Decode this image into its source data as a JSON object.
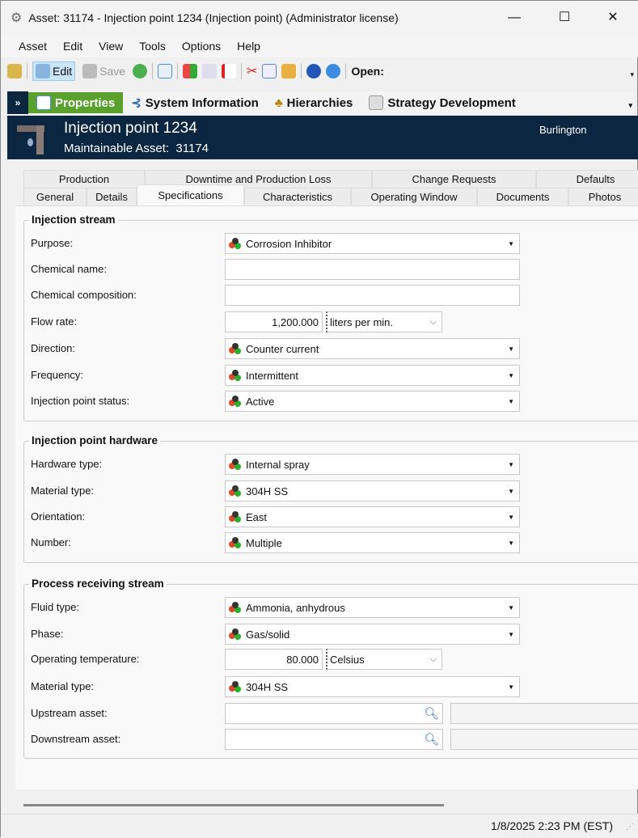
{
  "window": {
    "title": "Asset: 31174 - Injection point 1234 (Injection point) (Administrator license)"
  },
  "menu": [
    "Asset",
    "Edit",
    "View",
    "Tools",
    "Options",
    "Help"
  ],
  "toolbar": {
    "edit": "Edit",
    "save": "Save",
    "open": "Open:"
  },
  "nav": {
    "items": [
      "Properties",
      "System Information",
      "Hierarchies",
      "Strategy Development"
    ]
  },
  "header": {
    "title": "Injection point 1234",
    "subtitle": "Maintainable Asset:  31174",
    "location": "Burlington"
  },
  "tabs": {
    "row1": [
      "Production",
      "Downtime and Production Loss",
      "Change Requests",
      "Defaults"
    ],
    "row2": [
      "General",
      "Details",
      "Specifications",
      "Characteristics",
      "Operating Window",
      "Documents",
      "Photos"
    ],
    "active": "Specifications"
  },
  "groups": [
    {
      "title": "Injection stream",
      "rows": [
        {
          "label": "Purpose:",
          "type": "combo",
          "value": "Corrosion Inhibitor"
        },
        {
          "label": "Chemical name:",
          "type": "text",
          "value": ""
        },
        {
          "label": "Chemical composition:",
          "type": "text",
          "value": ""
        },
        {
          "label": "Flow rate:",
          "type": "unit",
          "value": "1,200.000",
          "unit": "liters per min."
        },
        {
          "label": "Direction:",
          "type": "combo",
          "value": "Counter current"
        },
        {
          "label": "Frequency:",
          "type": "combo",
          "value": "Intermittent"
        },
        {
          "label": "Injection point status:",
          "type": "combo",
          "value": "Active"
        }
      ]
    },
    {
      "title": "Injection point hardware",
      "rows": [
        {
          "label": "Hardware type:",
          "type": "combo",
          "value": "Internal spray"
        },
        {
          "label": "Material type:",
          "type": "combo",
          "value": "304H SS"
        },
        {
          "label": "Orientation:",
          "type": "combo",
          "value": "East"
        },
        {
          "label": "Number:",
          "type": "combo",
          "value": "Multiple"
        }
      ]
    },
    {
      "title": "Process receiving stream",
      "rows": [
        {
          "label": "Fluid type:",
          "type": "combo",
          "value": "Ammonia, anhydrous"
        },
        {
          "label": "Phase:",
          "type": "combo",
          "value": "Gas/solid"
        },
        {
          "label": "Operating temperature:",
          "type": "unit",
          "value": "80.000",
          "unit": "Celsius"
        },
        {
          "label": "Material type:",
          "type": "combo",
          "value": "304H SS"
        },
        {
          "label": "Upstream asset:",
          "type": "lookup",
          "value": ""
        },
        {
          "label": "Downstream asset:",
          "type": "lookup",
          "value": ""
        }
      ]
    }
  ],
  "status": {
    "datetime": "1/8/2025 2:23 PM (EST)"
  }
}
